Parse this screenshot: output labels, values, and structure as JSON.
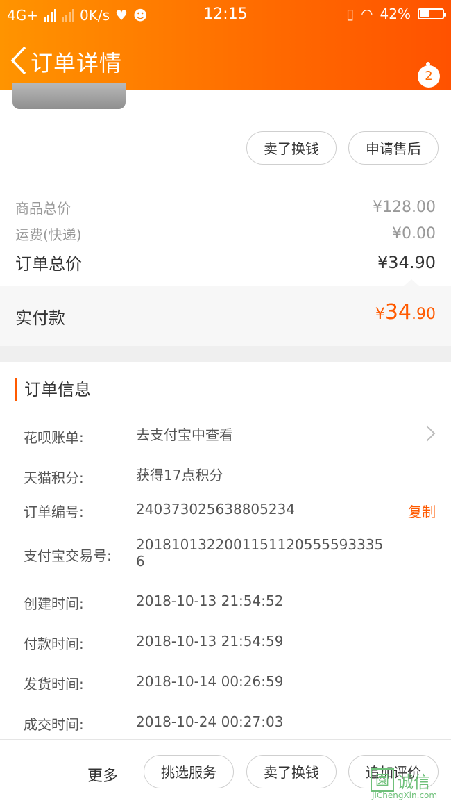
{
  "status_bar": {
    "network": "4G+",
    "speed": "0K/s",
    "time": "12:15",
    "battery": "42%"
  },
  "nav": {
    "title": "订单详情",
    "badge": "2"
  },
  "actions_top": [
    "卖了换钱",
    "申请售后"
  ],
  "price": {
    "goods_label": "商品总价",
    "goods_value": "¥128.00",
    "shipping_label": "运费(快递)",
    "shipping_value": "¥0.00",
    "total_label": "订单总价",
    "total_value": "¥34.90",
    "paid_label": "实付款",
    "paid_currency": "¥",
    "paid_int": "34",
    "paid_dec": ".90"
  },
  "order_info": {
    "title": "订单信息",
    "rows": [
      {
        "k": "花呗账单:",
        "v": "去支付宝中查看"
      },
      {
        "k": "天猫积分:",
        "v": "获得17点积分"
      },
      {
        "k": "订单编号:",
        "v": "240373025638805234",
        "action": "复制"
      },
      {
        "k": "支付宝交易号:",
        "v1": "2018101322001151120555593335",
        "v2": "6"
      },
      {
        "k": "创建时间:",
        "v": "2018-10-13 21:54:52"
      },
      {
        "k": "付款时间:",
        "v": "2018-10-13 21:54:59"
      },
      {
        "k": "发货时间:",
        "v": "2018-10-14 00:26:59"
      },
      {
        "k": "成交时间:",
        "v": "2018-10-24 00:27:03"
      }
    ]
  },
  "footer": {
    "more": "更多",
    "buttons": [
      "挑选服务",
      "卖了换钱",
      "追加评价"
    ]
  },
  "watermark": {
    "icon": "園",
    "cn": "诚信",
    "en": "JiChengXin.com"
  },
  "colors": {
    "accent": "#ff5a00",
    "header_start": "#ff9400",
    "header_end": "#ff5200"
  }
}
